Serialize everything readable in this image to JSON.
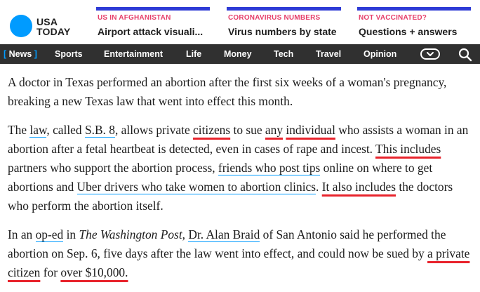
{
  "logo": {
    "line1": "USA",
    "line2": "TODAY"
  },
  "promos": [
    {
      "label": "US IN AFGHANISTAN",
      "title": "Airport attack visuali..."
    },
    {
      "label": "CORONAVIRUS NUMBERS",
      "title": "Virus numbers by state"
    },
    {
      "label": "NOT VACCINATED?",
      "title": "Questions + answers"
    }
  ],
  "nav": {
    "active": "News",
    "items": [
      "Sports",
      "Entertainment",
      "Life",
      "Money",
      "Tech",
      "Travel",
      "Opinion"
    ]
  },
  "colors": {
    "accent": "#009bff",
    "promo_bar": "#2e3bd6",
    "highlight": "#e8232c",
    "navbar": "#303030",
    "promo_label": "#e63f6a"
  },
  "article": {
    "p1": "A doctor in Texas performed an abortion after the first six weeks of a woman's pregnancy, breaking a new Texas law that went into effect this month.",
    "p2": [
      "The ",
      "law",
      ", called ",
      "S.B. 8",
      ", allows private ",
      "citizens",
      " to sue ",
      "any",
      " ",
      "individual",
      " who assists a woman in an abortion after a fetal heartbeat is detected, even in cases of rape and incest. ",
      "This includes",
      " partners who support the abortion process, ",
      "friends who post tips",
      " online on where to get abortions and ",
      "Uber drivers who take women to abortion clinics",
      ". ",
      "It also includes",
      " the doctors who perform the abortion itself."
    ],
    "p3": [
      "In an ",
      "op-ed",
      " in ",
      "The Washington Post",
      ", ",
      "Dr. Alan Braid",
      " of San Antonio said he performed the abortion on Sep. 6, five days after the law went into effect, and could now be sued by ",
      "a private citizen",
      " for ",
      "over $10,000."
    ]
  }
}
